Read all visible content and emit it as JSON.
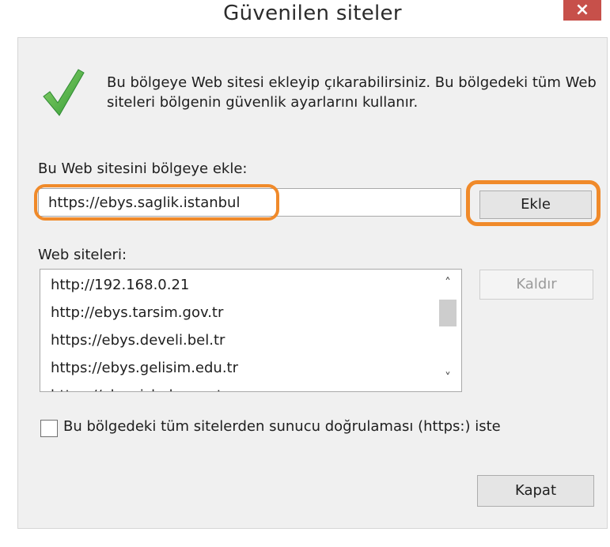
{
  "window": {
    "title": "Güvenilen siteler",
    "close_glyph": "×"
  },
  "info": {
    "icon": "checkmark-icon",
    "text": "Bu bölgeye Web sitesi ekleyip çıkarabilirsiniz. Bu bölgedeki tüm Web siteleri bölgenin güvenlik ayarlarını kullanır."
  },
  "add_site": {
    "label": "Bu Web sitesini bölgeye ekle:",
    "value": "https://ebys.saglik.istanbul",
    "button_label": "Ekle"
  },
  "sites": {
    "label": "Web siteleri:",
    "items": [
      "http://192.168.0.21",
      "http://ebys.tarsim.gov.tr",
      "https://ebys.develi.bel.tr",
      "https://ebys.gelisim.edu.tr",
      "https://ebys.ishak.com.tr"
    ],
    "remove_label": "Kaldır",
    "scroll_up_glyph": "˄",
    "scroll_down_glyph": "˅"
  },
  "https_option": {
    "label": "Bu bölgedeki tüm sitelerden sunucu doğrulaması (https:) iste",
    "checked": false
  },
  "footer": {
    "close_label": "Kapat"
  },
  "colors": {
    "highlight": "#f08a2a",
    "close_button_bg": "#c7504a",
    "check_green": "#4caf50"
  }
}
